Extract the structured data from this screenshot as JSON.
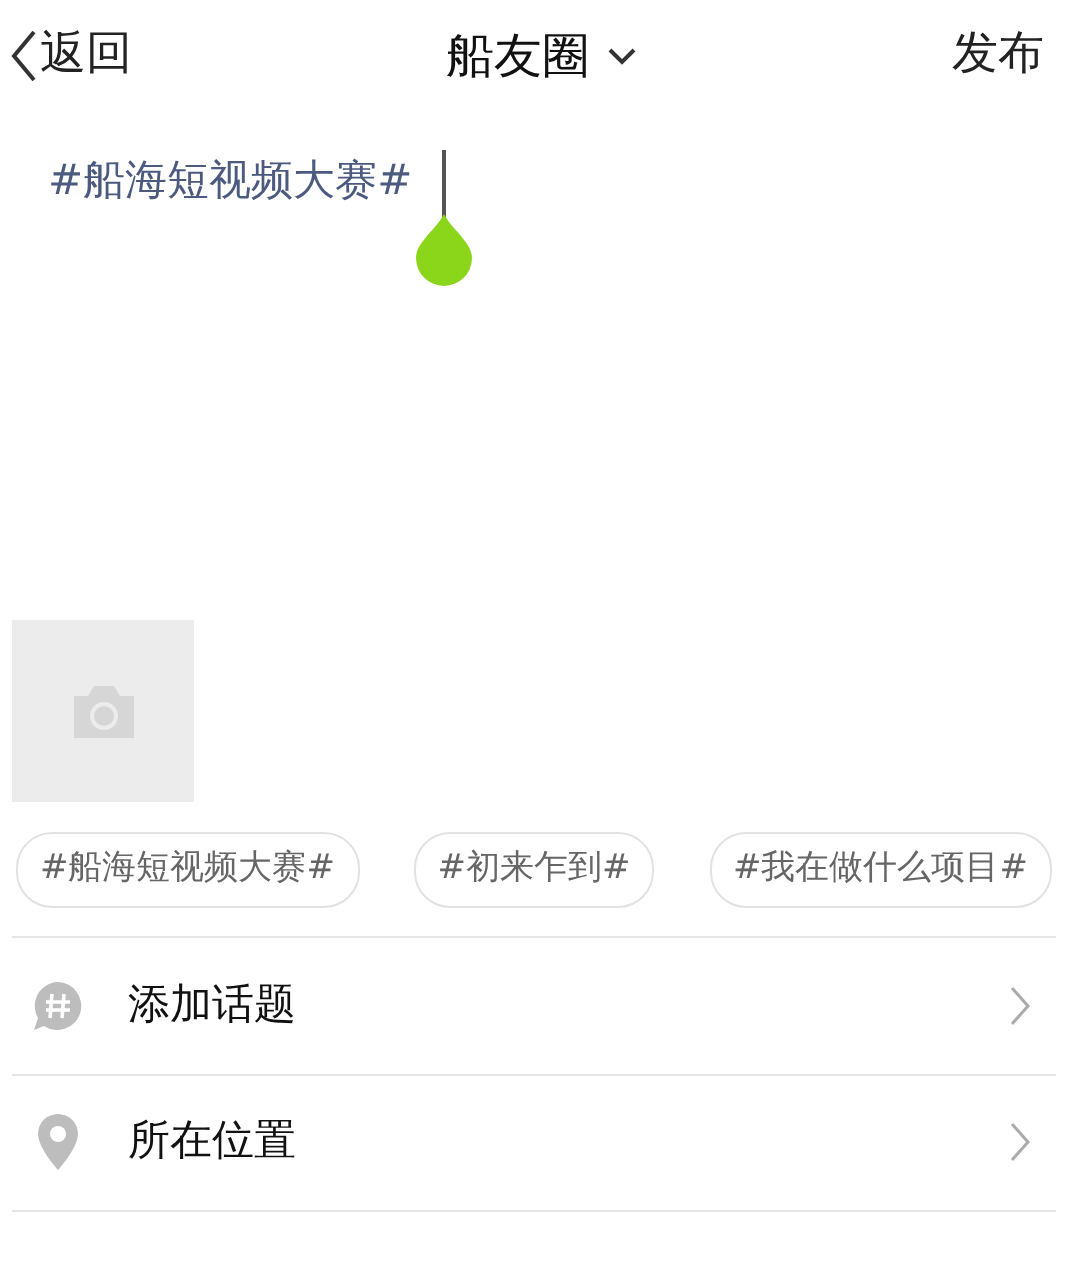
{
  "header": {
    "back": "返回",
    "title": "船友圈",
    "publish": "发布"
  },
  "post": {
    "text": "#船海短视频大赛#"
  },
  "topic_chips": [
    {
      "label": "#船海短视频大赛#"
    },
    {
      "label": "#初来乍到#"
    },
    {
      "label": "#我在做什么项目#"
    }
  ],
  "options": [
    {
      "kind": "topic",
      "label": "添加话题"
    },
    {
      "kind": "location",
      "label": "所在位置"
    }
  ]
}
